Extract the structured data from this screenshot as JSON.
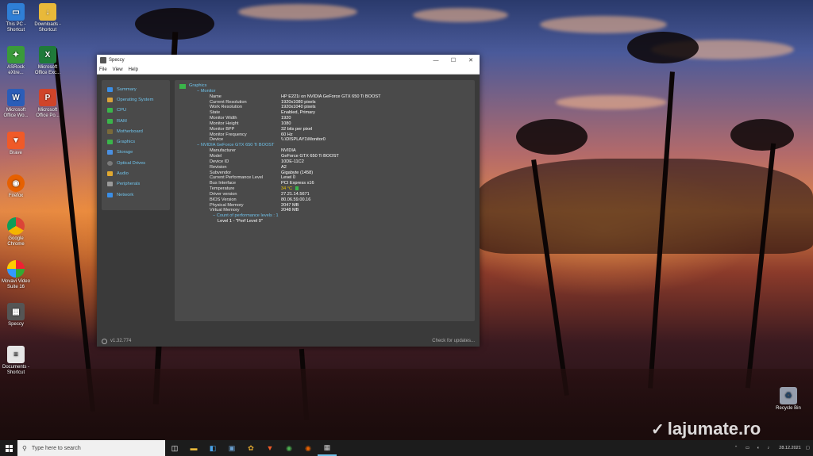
{
  "desktop_icons": [
    {
      "label": "This PC - Shortcut"
    },
    {
      "label": "Downloads - Shortcut"
    },
    {
      "label": "ASRock eXtre..."
    },
    {
      "label": "Microsoft Office Exc..."
    },
    {
      "label": "Microsoft Office Wo..."
    },
    {
      "label": "Microsoft Office Po..."
    },
    {
      "label": "Brave"
    },
    {
      "label": "Firefox"
    },
    {
      "label": "Google Chrome"
    },
    {
      "label": "Movavi Video Suite 16"
    },
    {
      "label": "Speccy"
    },
    {
      "label": "Documents - Shortcut"
    },
    {
      "label": "Recycle Bin"
    }
  ],
  "window": {
    "title": "Speccy",
    "minimize": "—",
    "maximize": "☐",
    "close": "✕",
    "menu": [
      "File",
      "View",
      "Help"
    ]
  },
  "sidebar": {
    "items": [
      "Summary",
      "Operating System",
      "CPU",
      "RAM",
      "Motherboard",
      "Graphics",
      "Storage",
      "Optical Drives",
      "Audio",
      "Peripherals",
      "Network"
    ],
    "icon_colors": [
      "#3a8ee6",
      "#d9a23a",
      "#3ab54a",
      "#3ab54a",
      "#7a6a3a",
      "#3ab54a",
      "#4a90e2",
      "#7a7a7a",
      "#e0a830",
      "#9a9a9a",
      "#3a8ee6"
    ]
  },
  "content": {
    "section": "Graphics",
    "monitor_header": "− Monitor",
    "monitor_rows": [
      [
        "Name",
        "HP E221i on NVIDIA GeForce GTX 650 Ti BOOST"
      ],
      [
        "Current Resolution",
        "1920x1080 pixels"
      ],
      [
        "Work Resolution",
        "1920x1040 pixels"
      ],
      [
        "State",
        "Enabled, Primary"
      ],
      [
        "Monitor Width",
        "1920"
      ],
      [
        "Monitor Height",
        "1080"
      ],
      [
        "Monitor BPP",
        "32 bits per pixel"
      ],
      [
        "Monitor Frequency",
        "60 Hz"
      ],
      [
        "Device",
        "\\\\.\\DISPLAY1\\Monitor0"
      ]
    ],
    "gpu_header": "− NVIDIA GeForce GTX 650 Ti BOOST",
    "gpu_rows": [
      [
        "Manufacturer",
        "NVIDIA"
      ],
      [
        "Model",
        "GeForce GTX 650 Ti BOOST"
      ],
      [
        "Device ID",
        "10DE-11C2"
      ],
      [
        "Revision",
        "A2"
      ],
      [
        "Subvendor",
        "Gigabyte (1458)"
      ],
      [
        "Current Performance Level",
        "Level 0"
      ],
      [
        "Bus Interface",
        "PCI Express x16"
      ],
      [
        "Temperature",
        "34 °C"
      ],
      [
        "Driver version",
        "27.21.14.5671"
      ],
      [
        "BIOS Version",
        "80.06.59.00.16"
      ],
      [
        "Physical Memory",
        "2047 MB"
      ],
      [
        "Virtual Memory",
        "2048 MB"
      ]
    ],
    "perf_header": "− Count of performance levels : 1",
    "perf_level": "Level 1 - \"Perf Level 0\""
  },
  "status": {
    "version": "v1.32.774",
    "check_updates": "Check for updates..."
  },
  "taskbar": {
    "search_placeholder": "Type here to search",
    "time": "28.12.2021"
  },
  "watermark": "lajumate.ro",
  "colors": {
    "accent": "#6fc2ea",
    "temperature": "#e6c200"
  }
}
